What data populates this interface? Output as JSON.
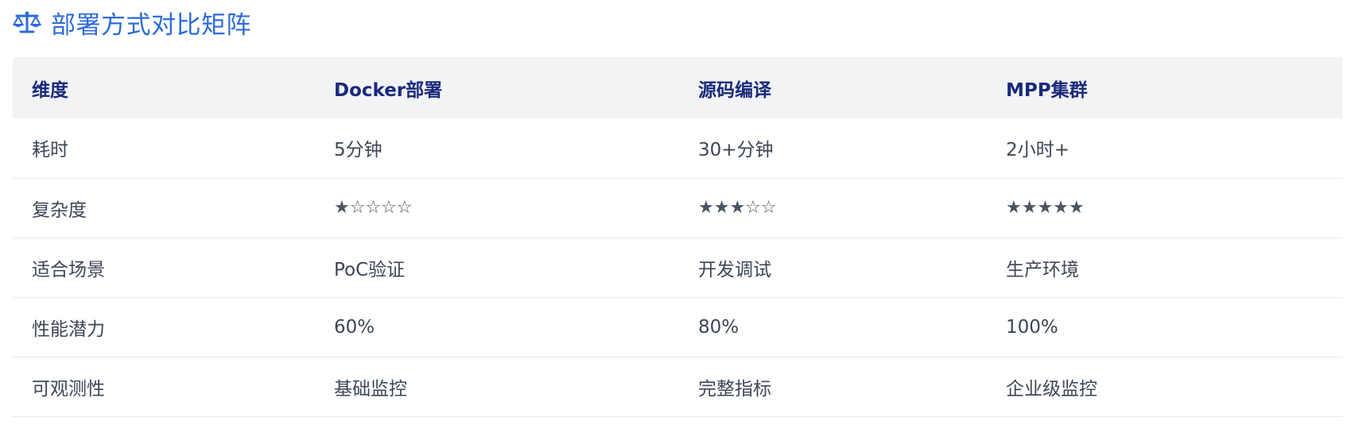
{
  "title": "部署方式对比矩阵",
  "title_icon": "scale-balance-icon",
  "accent_color": "#2f6bd8",
  "header_color": "#1a2a7a",
  "table": {
    "headers": [
      "维度",
      "Docker部署",
      "源码编译",
      "MPP集群"
    ],
    "rows": [
      {
        "dimension": "耗时",
        "docker": "5分钟",
        "source": "30+分钟",
        "mpp": "2小时+"
      },
      {
        "dimension": "复杂度",
        "docker": "★☆☆☆☆",
        "source": "★★★☆☆",
        "mpp": "★★★★★"
      },
      {
        "dimension": "适合场景",
        "docker": "PoC验证",
        "source": "开发调试",
        "mpp": "生产环境"
      },
      {
        "dimension": "性能潜力",
        "docker": "60%",
        "source": "80%",
        "mpp": "100%"
      },
      {
        "dimension": "可观测性",
        "docker": "基础监控",
        "source": "完整指标",
        "mpp": "企业级监控"
      }
    ]
  }
}
